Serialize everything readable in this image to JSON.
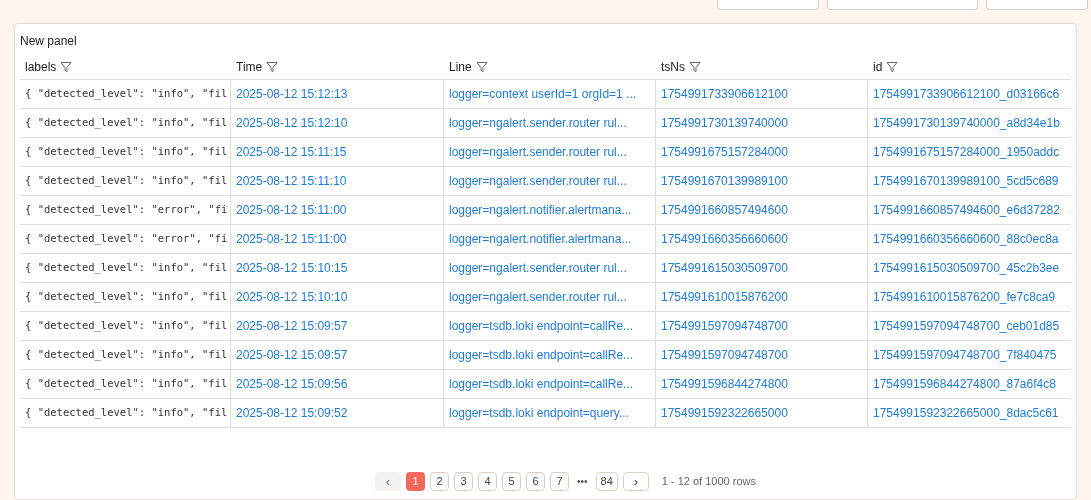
{
  "panel": {
    "title": "New panel"
  },
  "table": {
    "columns": [
      "labels",
      "Time",
      "Line",
      "tsNs",
      "id"
    ],
    "rows": [
      [
        "{ \"detected_level\": \"info\", \"fil",
        "2025-08-12 15:12:13",
        "logger=context userId=1 orgId=1 ...",
        "1754991733906612100",
        "1754991733906612100_d03166c6"
      ],
      [
        "{ \"detected_level\": \"info\", \"fil",
        "2025-08-12 15:12:10",
        "logger=ngalert.sender.router rul...",
        "1754991730139740000",
        "1754991730139740000_a8d34e1b"
      ],
      [
        "{ \"detected_level\": \"info\", \"fil",
        "2025-08-12 15:11:15",
        "logger=ngalert.sender.router rul...",
        "1754991675157284000",
        "1754991675157284000_1950addc"
      ],
      [
        "{ \"detected_level\": \"info\", \"fil",
        "2025-08-12 15:11:10",
        "logger=ngalert.sender.router rul...",
        "1754991670139989100",
        "1754991670139989100_5cd5c689"
      ],
      [
        "{ \"detected_level\": \"error\", \"fi",
        "2025-08-12 15:11:00",
        "logger=ngalert.notifier.alertmana...",
        "1754991660857494600",
        "1754991660857494600_e6d37282"
      ],
      [
        "{ \"detected_level\": \"error\", \"fi",
        "2025-08-12 15:11:00",
        "logger=ngalert.notifier.alertmana...",
        "1754991660356660600",
        "1754991660356660600_88c0ec8a"
      ],
      [
        "{ \"detected_level\": \"info\", \"fil",
        "2025-08-12 15:10:15",
        "logger=ngalert.sender.router rul...",
        "1754991615030509700",
        "1754991615030509700_45c2b3ee"
      ],
      [
        "{ \"detected_level\": \"info\", \"fil",
        "2025-08-12 15:10:10",
        "logger=ngalert.sender.router rul...",
        "1754991610015876200",
        "1754991610015876200_fe7c8ca9"
      ],
      [
        "{ \"detected_level\": \"info\", \"fil",
        "2025-08-12 15:09:57",
        "logger=tsdb.loki endpoint=callRe...",
        "1754991597094748700",
        "1754991597094748700_ceb01d85"
      ],
      [
        "{ \"detected_level\": \"info\", \"fil",
        "2025-08-12 15:09:57",
        "logger=tsdb.loki endpoint=callRe...",
        "1754991597094748700",
        "1754991597094748700_7f840475"
      ],
      [
        "{ \"detected_level\": \"info\", \"fil",
        "2025-08-12 15:09:56",
        "logger=tsdb.loki endpoint=callRe...",
        "1754991596844274800",
        "1754991596844274800_87a6f4c8"
      ],
      [
        "{ \"detected_level\": \"info\", \"fil",
        "2025-08-12 15:09:52",
        "logger=tsdb.loki endpoint=query...",
        "1754991592322665000",
        "1754991592322665000_8dac5c61"
      ]
    ]
  },
  "pagination": {
    "pages": [
      {
        "label": "1",
        "selected": true
      },
      {
        "label": "2",
        "selected": false
      },
      {
        "label": "3",
        "selected": false
      },
      {
        "label": "4",
        "selected": false
      },
      {
        "label": "5",
        "selected": false
      },
      {
        "label": "6",
        "selected": false
      },
      {
        "label": "7",
        "selected": false
      },
      {
        "label": "•••",
        "kind": "ellipsis"
      },
      {
        "label": "84",
        "selected": false
      }
    ],
    "prev": "‹",
    "next": "›",
    "summary": "1 - 12 of 1000 rows"
  }
}
